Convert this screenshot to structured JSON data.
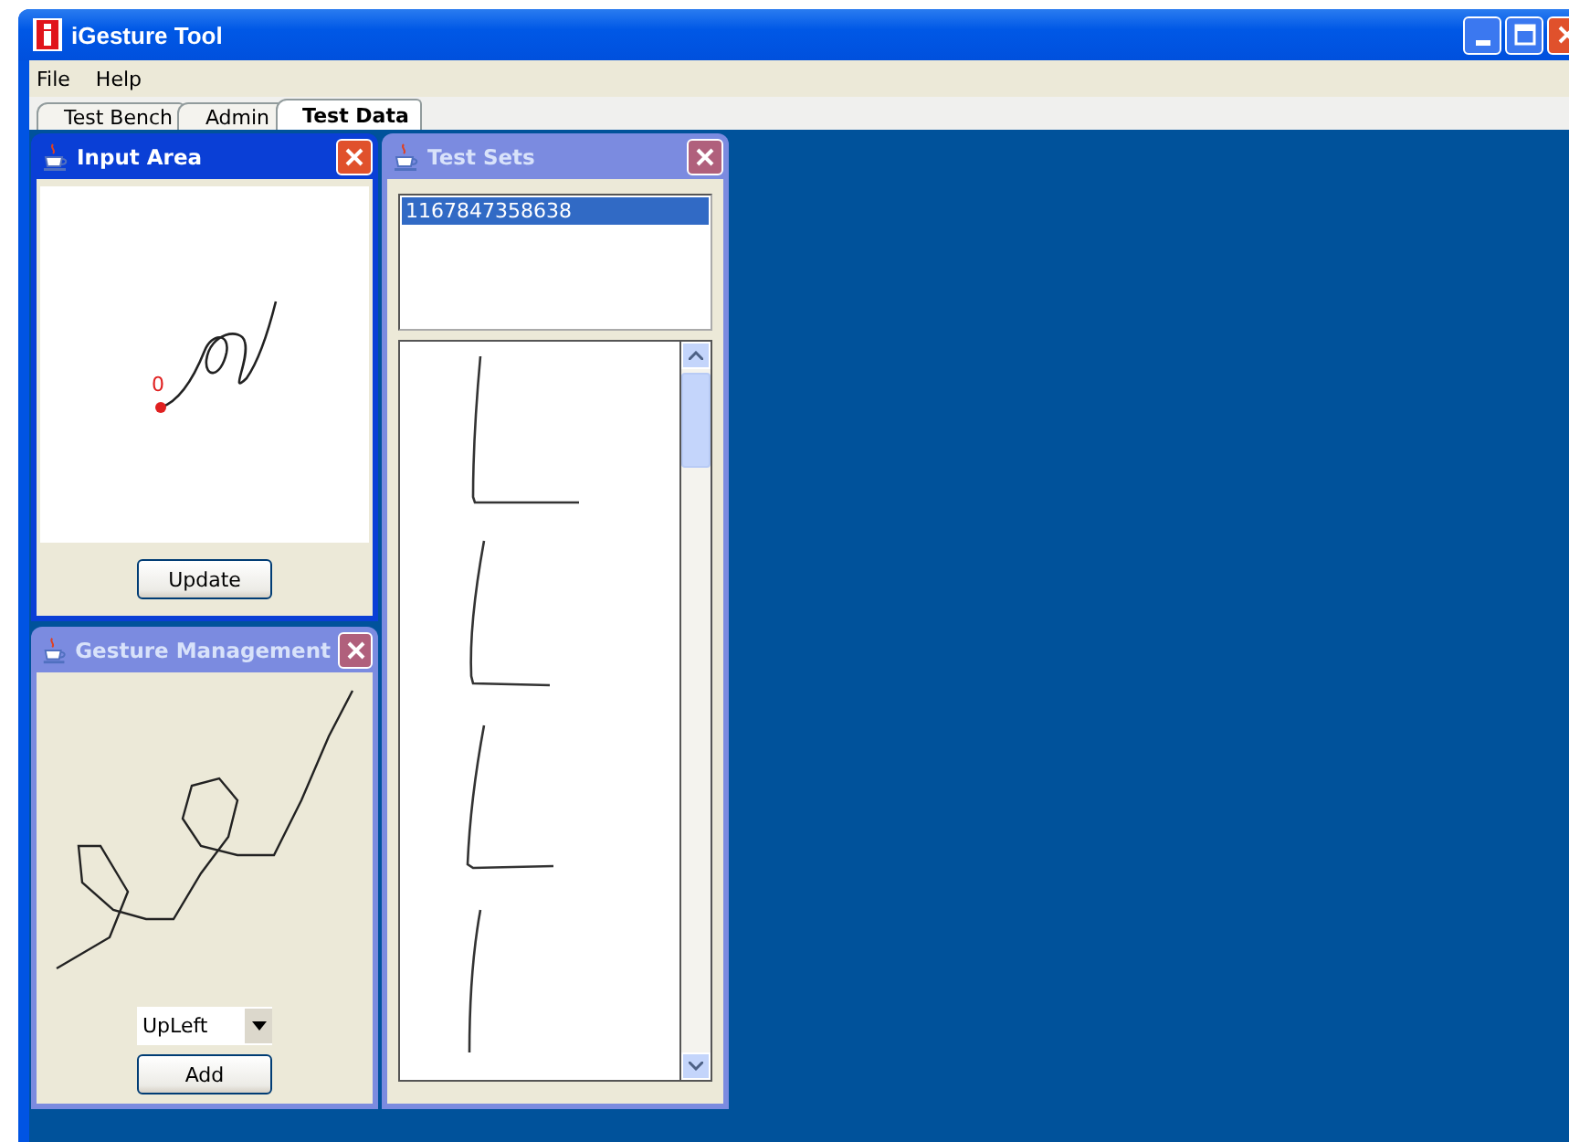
{
  "window": {
    "title": "iGesture Tool"
  },
  "menu": [
    "File",
    "Help"
  ],
  "tabs": [
    {
      "label": "Test Bench",
      "selected": false
    },
    {
      "label": "Admin",
      "selected": false
    },
    {
      "label": "Test Data",
      "selected": true
    }
  ],
  "input_area": {
    "title": "Input Area",
    "active": true,
    "start_label": "0",
    "button": "Update"
  },
  "gesture_management": {
    "title": "Gesture Management",
    "active": false,
    "dropdown": "UpLeft",
    "button": "Add"
  },
  "test_sets": {
    "title": "Test Sets",
    "active": false,
    "items": [
      {
        "label": "1167847358638",
        "selected": true
      }
    ]
  }
}
